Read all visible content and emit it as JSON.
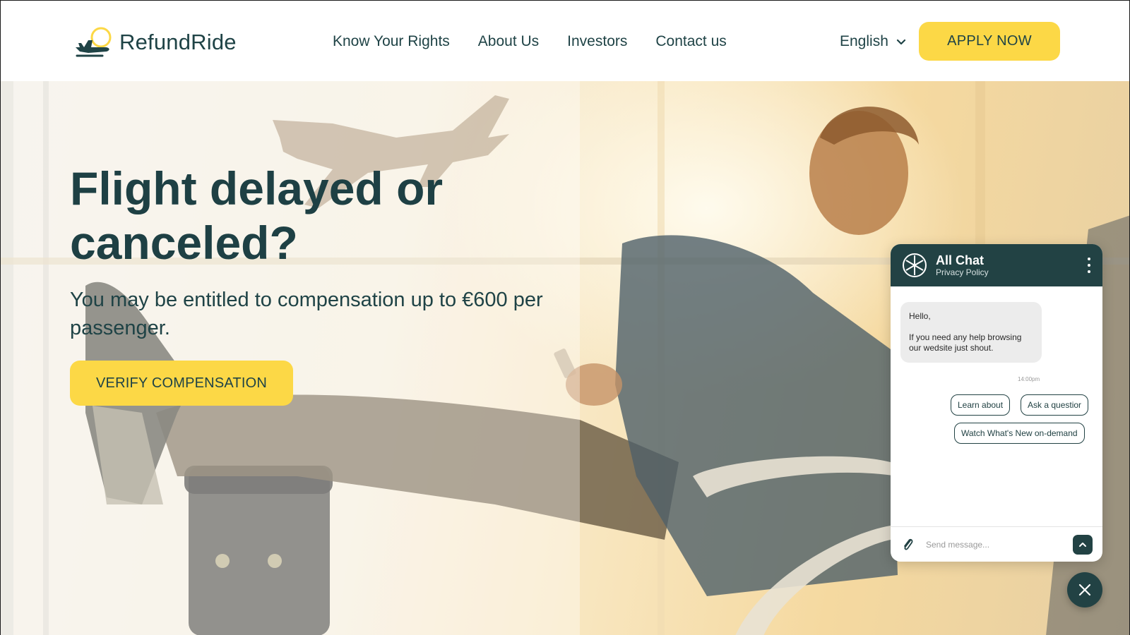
{
  "brand": {
    "name": "RefundRide",
    "logo_icon": "plane-logo-icon",
    "accent": "#fcd846",
    "dark": "#1f4346"
  },
  "nav": {
    "items": [
      {
        "label": "Know Your Rights"
      },
      {
        "label": "About Us"
      },
      {
        "label": "Investors"
      },
      {
        "label": "Contact us"
      }
    ],
    "language": "English",
    "language_icon": "chevron-down-icon",
    "apply_label": "APPLY NOW"
  },
  "hero": {
    "title": "Flight delayed or canceled?",
    "subtitle": "You may be entitled to compensation up to €600 per passenger.",
    "cta_label": "VERIFY COMPENSATION"
  },
  "chat": {
    "title": "All Chat",
    "subtitle": "Privacy Policy",
    "header_bg": "#224244",
    "greeting": "Hello,",
    "message": "If you need any help browsing our wedsite just shout.",
    "time": "14:00pm",
    "quick_replies": {
      "learn": "Learn about",
      "ask": "Ask a questior",
      "watch": "Watch What's New on-demand"
    },
    "input_placeholder": "Send message...",
    "icons": {
      "logo": "chat-logo-icon",
      "menu": "more-vertical-icon",
      "attach": "paperclip-icon",
      "send": "chevron-up-icon",
      "close": "close-icon"
    }
  }
}
